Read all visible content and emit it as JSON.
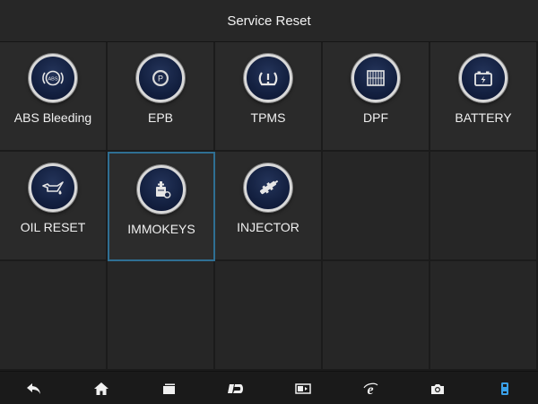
{
  "header": {
    "title": "Service Reset"
  },
  "colors": {
    "accent": "#2f6f93",
    "active_nav": "#3aa0e8"
  },
  "tiles": [
    {
      "label": "ABS Bleeding",
      "icon": "abs-icon"
    },
    {
      "label": "EPB",
      "icon": "parking-brake-icon"
    },
    {
      "label": "TPMS",
      "icon": "tire-pressure-icon"
    },
    {
      "label": "DPF",
      "icon": "dpf-filter-icon"
    },
    {
      "label": "BATTERY",
      "icon": "battery-icon"
    },
    {
      "label": "OIL RESET",
      "icon": "oil-can-icon"
    },
    {
      "label": "IMMOKEYS",
      "icon": "immokey-icon",
      "selected": true
    },
    {
      "label": "INJECTOR",
      "icon": "injector-icon"
    }
  ],
  "bottom_nav": [
    {
      "icon": "back-arrow-icon"
    },
    {
      "icon": "home-icon"
    },
    {
      "icon": "windows-icon"
    },
    {
      "icon": "brand-logo-icon"
    },
    {
      "icon": "display-settings-icon"
    },
    {
      "icon": "browser-icon"
    },
    {
      "icon": "camera-icon"
    },
    {
      "icon": "vci-connector-icon",
      "active": true
    }
  ]
}
